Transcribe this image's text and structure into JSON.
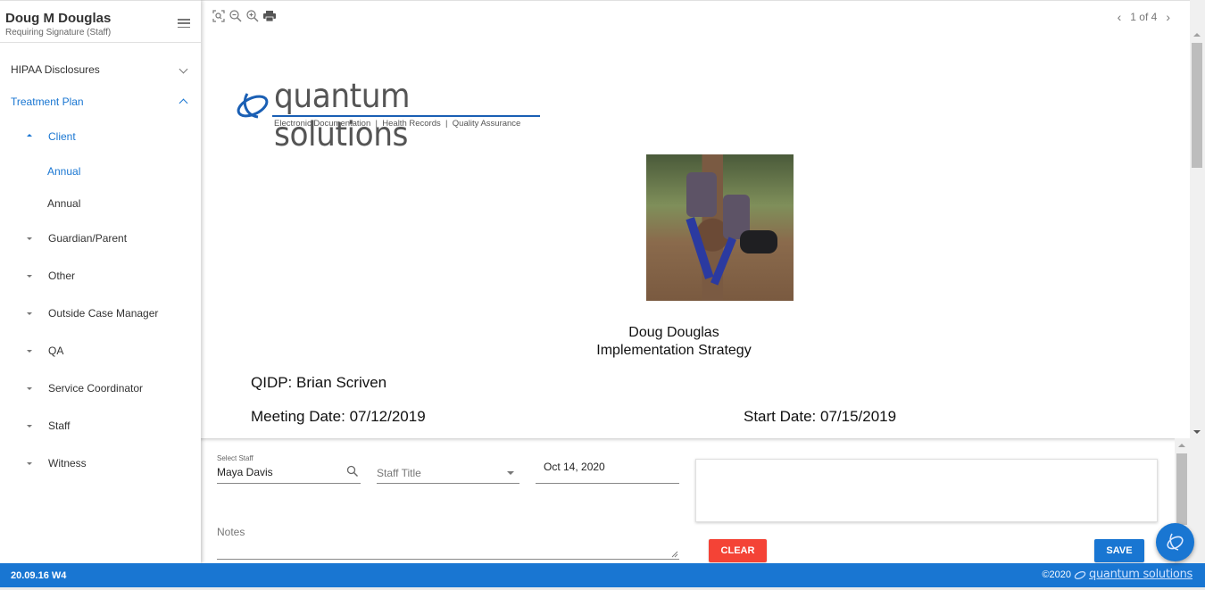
{
  "sidebar": {
    "user_name": "Doug M Douglas",
    "user_status": "Requiring Signature (Staff)",
    "menu_icon": "hamburger-icon",
    "sections": [
      {
        "label": "HIPAA Disclosures",
        "expanded": false
      },
      {
        "label": "Treatment Plan",
        "expanded": true
      }
    ],
    "groups": [
      {
        "label": "Client",
        "expanded": true,
        "children": [
          {
            "label": "Annual",
            "active": true
          },
          {
            "label": "Annual",
            "active": false
          }
        ]
      },
      {
        "label": "Guardian/Parent",
        "expanded": false
      },
      {
        "label": "Other",
        "expanded": false
      },
      {
        "label": "Outside Case Manager",
        "expanded": false
      },
      {
        "label": "QA",
        "expanded": false
      },
      {
        "label": "Service Coordinator",
        "expanded": false
      },
      {
        "label": "Staff",
        "expanded": false
      },
      {
        "label": "Witness",
        "expanded": false
      }
    ]
  },
  "viewer": {
    "tools": [
      "fit-page-icon",
      "zoom-out-icon",
      "zoom-in-icon",
      "print-icon"
    ],
    "pager": {
      "prev": "‹",
      "label": "1 of 4",
      "next": "›"
    },
    "logo": {
      "brand": "quantum solutions",
      "tagline": "Electronic Documentation  |  Health Records  |  Quality Assurance"
    },
    "photo_alt": "client photo",
    "document": {
      "name": "Doug Douglas",
      "title": "Implementation Strategy",
      "qidp_label": "QIDP:",
      "qidp_value": "Brian Scriven",
      "meeting_label": "Meeting Date:",
      "meeting_value": "07/12/2019",
      "start_label": "Start Date:",
      "start_value": "07/15/2019"
    }
  },
  "signature": {
    "staff_label": "Select Staff",
    "staff_value": "Maya Davis",
    "staff_title_placeholder": "Staff Title",
    "date_value": "Oct 14, 2020",
    "notes_placeholder": "Notes",
    "clear_label": "CLEAR",
    "save_label": "SAVE"
  },
  "footer": {
    "version": "20.09.16 W4",
    "copyright": "©2020",
    "brand": "quantum solutions"
  },
  "colors": {
    "accent": "#1976d2",
    "danger": "#f44336"
  }
}
